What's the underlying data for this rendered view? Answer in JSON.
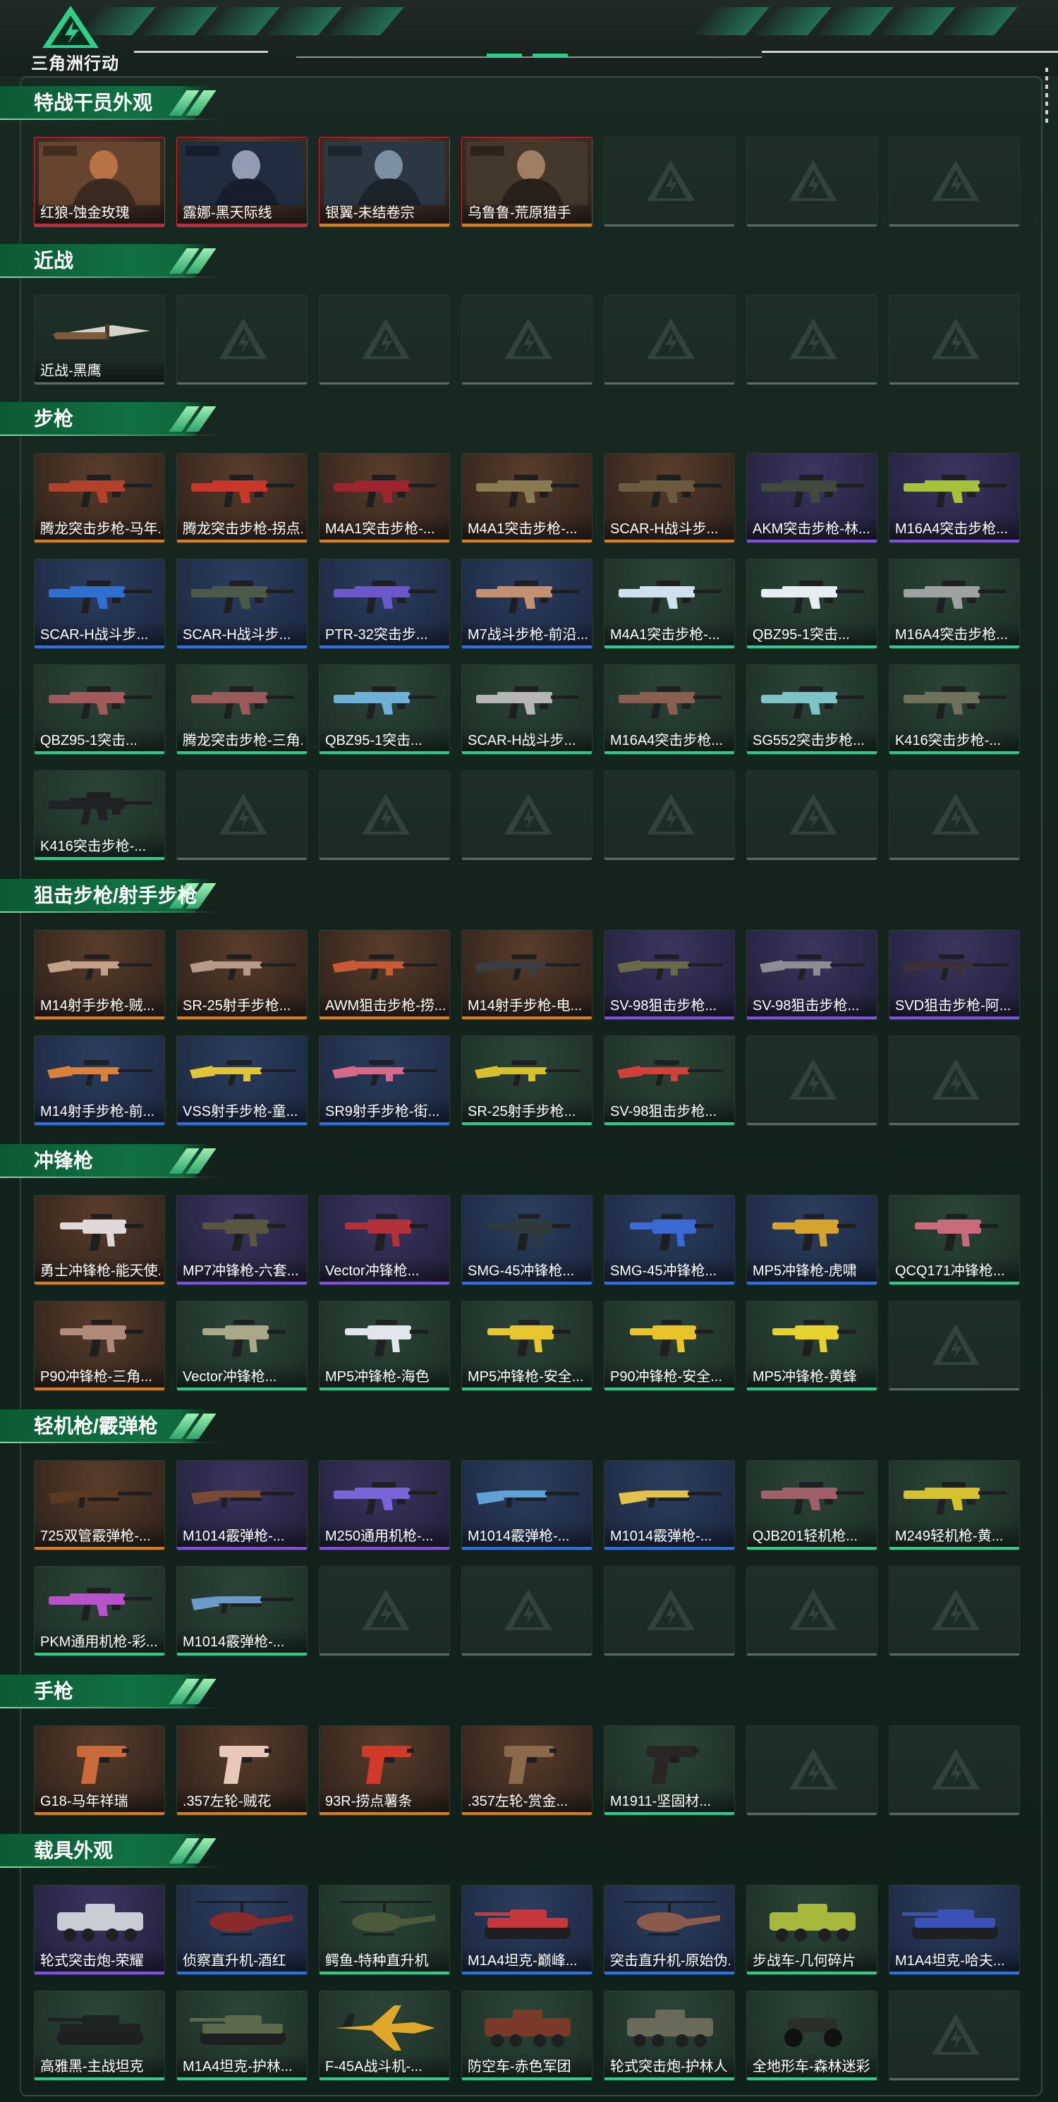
{
  "header": {
    "brand": "三角洲行动"
  },
  "colors": {
    "gold": "#d97c1e",
    "purple": "#7e4fe0",
    "blue": "#2f6fe6",
    "green": "#2fc98b",
    "red": "#c8283c",
    "accent": "#2fcf89"
  },
  "sections": [
    {
      "title": "特战干员外观",
      "items": [
        {
          "label": "红狼-蚀金玫瑰",
          "rarity": "red",
          "kind": "operator"
        },
        {
          "label": "露娜-黑天际线",
          "rarity": "red",
          "kind": "operator"
        },
        {
          "label": "银翼-未结卷宗",
          "rarity": "gold",
          "kind": "operator"
        },
        {
          "label": "乌鲁鲁-荒原猎手",
          "rarity": "gold",
          "kind": "operator"
        },
        null,
        null,
        null
      ]
    },
    {
      "title": "近战",
      "items": [
        {
          "label": "近战-黑鹰",
          "rarity": "empty",
          "kind": "knife"
        },
        null,
        null,
        null,
        null,
        null,
        null
      ]
    },
    {
      "title": "步枪",
      "items": [
        {
          "label": "腾龙突击步枪-马年...",
          "rarity": "gold",
          "kind": "rifle",
          "icon": "#b2412c"
        },
        {
          "label": "腾龙突击步枪-拐点...",
          "rarity": "gold",
          "kind": "rifle",
          "icon": "#c9372b"
        },
        {
          "label": "M4A1突击步枪-...",
          "rarity": "gold",
          "kind": "rifle",
          "icon": "#9e2430"
        },
        {
          "label": "M4A1突击步枪-...",
          "rarity": "gold",
          "kind": "rifle",
          "icon": "#8a7a52"
        },
        {
          "label": "SCAR-H战斗步...",
          "rarity": "gold",
          "kind": "rifle",
          "icon": "#6b5a3e"
        },
        {
          "label": "AKM突击步枪-林...",
          "rarity": "purple",
          "kind": "rifle",
          "icon": "#3f4a3c"
        },
        {
          "label": "M16A4突击步枪...",
          "rarity": "purple",
          "kind": "rifle",
          "icon": "#a6c23a"
        },
        {
          "label": "SCAR-H战斗步...",
          "rarity": "blue",
          "kind": "rifle",
          "icon": "#2f6fd0"
        },
        {
          "label": "SCAR-H战斗步...",
          "rarity": "blue",
          "kind": "rifle",
          "icon": "#4c5a4a"
        },
        {
          "label": "PTR-32突击步...",
          "rarity": "blue",
          "kind": "rifle",
          "icon": "#6a58c8"
        },
        {
          "label": "M7战斗步枪-前沿...",
          "rarity": "blue",
          "kind": "rifle",
          "icon": "#c09070"
        },
        {
          "label": "M4A1突击步枪-...",
          "rarity": "green",
          "kind": "rifle",
          "icon": "#d0e0ee"
        },
        {
          "label": "QBZ95-1突击...",
          "rarity": "green",
          "kind": "rifle",
          "icon": "#e6eef2"
        },
        {
          "label": "M16A4突击步枪...",
          "rarity": "green",
          "kind": "rifle",
          "icon": "#9ea3a2"
        },
        {
          "label": "QBZ95-1突击...",
          "rarity": "green",
          "kind": "rifle",
          "icon": "#a05a5a"
        },
        {
          "label": "腾龙突击步枪-三角...",
          "rarity": "green",
          "kind": "rifle",
          "icon": "#9a5a5a"
        },
        {
          "label": "QBZ95-1突击...",
          "rarity": "green",
          "kind": "rifle",
          "icon": "#6fb0d6"
        },
        {
          "label": "SCAR-H战斗步...",
          "rarity": "green",
          "kind": "rifle",
          "icon": "#b6b6b6"
        },
        {
          "label": "M16A4突击步枪...",
          "rarity": "green",
          "kind": "rifle",
          "icon": "#8a5e4e"
        },
        {
          "label": "SG552突击步枪...",
          "rarity": "green",
          "kind": "rifle",
          "icon": "#7ec3c8"
        },
        {
          "label": "K416突击步枪-...",
          "rarity": "green",
          "kind": "rifle",
          "icon": "#6f7258"
        },
        {
          "label": "K416突击步枪-...",
          "rarity": "green",
          "kind": "rifle",
          "icon": "#1e2224"
        },
        null,
        null,
        null,
        null,
        null,
        null
      ]
    },
    {
      "title": "狙击步枪/射手步枪",
      "items": [
        {
          "label": "M14射手步枪-贼...",
          "rarity": "gold",
          "kind": "sniper",
          "icon": "#c2a089"
        },
        {
          "label": "SR-25射手步枪...",
          "rarity": "gold",
          "kind": "sniper",
          "icon": "#b89a88"
        },
        {
          "label": "AWM狙击步枪-捞...",
          "rarity": "gold",
          "kind": "sniper",
          "icon": "#c85a36"
        },
        {
          "label": "M14射手步枪-电...",
          "rarity": "gold",
          "kind": "sniper",
          "icon": "#3a3e42"
        },
        {
          "label": "SV-98狙击步枪...",
          "rarity": "purple",
          "kind": "sniper",
          "icon": "#6a6a48"
        },
        {
          "label": "SV-98狙击步枪...",
          "rarity": "purple",
          "kind": "sniper",
          "icon": "#8c8e94"
        },
        {
          "label": "SVD狙击步枪-阿...",
          "rarity": "purple",
          "kind": "sniper",
          "icon": "#3b2f38"
        },
        {
          "label": "M14射手步枪-前...",
          "rarity": "blue",
          "kind": "sniper",
          "icon": "#d9833a"
        },
        {
          "label": "VSS射手步枪-童...",
          "rarity": "blue",
          "kind": "sniper",
          "icon": "#e0c43a"
        },
        {
          "label": "SR9射手步枪-街...",
          "rarity": "blue",
          "kind": "sniper",
          "icon": "#d36a8a"
        },
        {
          "label": "SR-25射手步枪...",
          "rarity": "green",
          "kind": "sniper",
          "icon": "#d6c02e"
        },
        {
          "label": "SV-98狙击步枪...",
          "rarity": "green",
          "kind": "sniper",
          "icon": "#d2403a"
        },
        null,
        null
      ]
    },
    {
      "title": "冲锋枪",
      "items": [
        {
          "label": "勇士冲锋枪-能天使...",
          "rarity": "gold",
          "kind": "smg",
          "icon": "#e0d7d8"
        },
        {
          "label": "MP7冲锋枪-六套...",
          "rarity": "purple",
          "kind": "smg",
          "icon": "#5a5540"
        },
        {
          "label": "Vector冲锋枪...",
          "rarity": "purple",
          "kind": "smg",
          "icon": "#b3323a"
        },
        {
          "label": "SMG-45冲锋枪...",
          "rarity": "blue",
          "kind": "smg",
          "icon": "#2e3a3e"
        },
        {
          "label": "SMG-45冲锋枪...",
          "rarity": "blue",
          "kind": "smg",
          "icon": "#3a6ad2"
        },
        {
          "label": "MP5冲锋枪-虎啸",
          "rarity": "blue",
          "kind": "smg",
          "icon": "#d6a32e"
        },
        {
          "label": "QCQ171冲锋枪...",
          "rarity": "green",
          "kind": "smg",
          "icon": "#c86b7a"
        },
        {
          "label": "P90冲锋枪-三角...",
          "rarity": "gold",
          "kind": "smg",
          "icon": "#b08a7a"
        },
        {
          "label": "Vector冲锋枪...",
          "rarity": "green",
          "kind": "smg",
          "icon": "#a9a98a"
        },
        {
          "label": "MP5冲锋枪-海色",
          "rarity": "green",
          "kind": "smg",
          "icon": "#e0e6ec"
        },
        {
          "label": "MP5冲锋枪-安全...",
          "rarity": "green",
          "kind": "smg",
          "icon": "#e6c82e"
        },
        {
          "label": "P90冲锋枪-安全...",
          "rarity": "green",
          "kind": "smg",
          "icon": "#e8c32a"
        },
        {
          "label": "MP5冲锋枪-黄蜂",
          "rarity": "green",
          "kind": "smg",
          "icon": "#e6d12e"
        },
        null
      ]
    },
    {
      "title": "轻机枪/霰弹枪",
      "items": [
        {
          "label": "725双管霰弹枪-...",
          "rarity": "gold",
          "kind": "shotgun",
          "icon": "#5a3a22"
        },
        {
          "label": "M1014霰弹枪-...",
          "rarity": "purple",
          "kind": "shotgun",
          "icon": "#7a4a36"
        },
        {
          "label": "M250通用机枪-...",
          "rarity": "purple",
          "kind": "lmg",
          "icon": "#7b63d8"
        },
        {
          "label": "M1014霰弹枪-...",
          "rarity": "blue",
          "kind": "shotgun",
          "icon": "#5fa0d6"
        },
        {
          "label": "M1014霰弹枪-...",
          "rarity": "blue",
          "kind": "shotgun",
          "icon": "#e2c24a"
        },
        {
          "label": "QJB201轻机枪...",
          "rarity": "green",
          "kind": "lmg",
          "icon": "#a0606a"
        },
        {
          "label": "M249轻机枪-黄...",
          "rarity": "green",
          "kind": "lmg",
          "icon": "#d6c22e"
        },
        {
          "label": "PKM通用机枪-彩...",
          "rarity": "green",
          "kind": "lmg",
          "icon": "#b852c8"
        },
        {
          "label": "M1014霰弹枪-...",
          "rarity": "green",
          "kind": "shotgun",
          "icon": "#6a9ac8"
        },
        null,
        null,
        null,
        null,
        null
      ]
    },
    {
      "title": "手枪",
      "items": [
        {
          "label": "G18-马年祥瑞",
          "rarity": "gold",
          "kind": "pistol",
          "icon": "#c86a3a"
        },
        {
          "label": ".357左轮-贼花",
          "rarity": "gold",
          "kind": "revolver",
          "icon": "#e8c8b8"
        },
        {
          "label": "93R-捞点薯条",
          "rarity": "gold",
          "kind": "pistol",
          "icon": "#d03a2a"
        },
        {
          "label": ".357左轮-赏金...",
          "rarity": "gold",
          "kind": "revolver",
          "icon": "#8a6a4a"
        },
        {
          "label": "M1911-坚固材...",
          "rarity": "green",
          "kind": "pistol",
          "icon": "#2a2626"
        },
        null,
        null
      ]
    },
    {
      "title": "载具外观",
      "items": [
        {
          "label": "轮式突击炮-荣耀",
          "rarity": "purple",
          "kind": "apc",
          "icon": "#c8ccd4"
        },
        {
          "label": "侦察直升机-酒红",
          "rarity": "blue",
          "kind": "heli",
          "icon": "#8a2a2a"
        },
        {
          "label": "鳄鱼-特种直升机",
          "rarity": "green",
          "kind": "heli",
          "icon": "#4a5a3a"
        },
        {
          "label": "M1A4坦克-巅峰...",
          "rarity": "blue",
          "kind": "tank",
          "icon": "#c8383a"
        },
        {
          "label": "突击直升机-原始伪...",
          "rarity": "blue",
          "kind": "heli",
          "icon": "#8a5a4a"
        },
        {
          "label": "步战车-几何碎片",
          "rarity": "green",
          "kind": "apc",
          "icon": "#a8b83a"
        },
        {
          "label": "M1A4坦克-哈夫...",
          "rarity": "blue",
          "kind": "tank",
          "icon": "#3a52b8"
        },
        {
          "label": "高雅黑-主战坦克",
          "rarity": "green",
          "kind": "tank",
          "icon": "#1e2222"
        },
        {
          "label": "M1A4坦克-护林...",
          "rarity": "green",
          "kind": "tank",
          "icon": "#5a6a4a"
        },
        {
          "label": "F-45A战斗机-...",
          "rarity": "green",
          "kind": "jet",
          "icon": "#e0a828"
        },
        {
          "label": "防空车-赤色军团",
          "rarity": "green",
          "kind": "apc",
          "icon": "#7a3a2a"
        },
        {
          "label": "轮式突击炮-护林人",
          "rarity": "green",
          "kind": "apc",
          "icon": "#6a6a5a"
        },
        {
          "label": "全地形车-森林迷彩",
          "rarity": "green",
          "kind": "atv",
          "icon": "#2a2e28"
        },
        null
      ]
    }
  ]
}
